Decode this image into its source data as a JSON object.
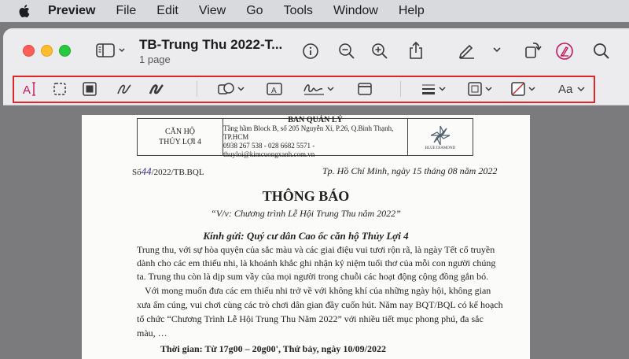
{
  "menubar": {
    "app_name": "Preview",
    "items": [
      "File",
      "Edit",
      "View",
      "Go",
      "Tools",
      "Window",
      "Help"
    ]
  },
  "window": {
    "title": "TB-Trung Thu 2022-T...",
    "subtitle": "1 page",
    "font_size_label": "Aa"
  },
  "document": {
    "header_left_1": "CĂN HỘ",
    "header_left_2": "THỦY LỢI 4",
    "header_mid_title": "BAN QUẢN LÝ",
    "header_mid_1": "Tầng hầm Block B, số 205 Nguyễn Xí, P.26, Q.Bình Thạnh, TP.HCM",
    "header_mid_2": "0938 267 538 - 028 6682 5571 - thuyloi@kimcuongxanh.com.vn",
    "logo_text": "BLUE DIAMOND",
    "ref_prefix": "Số",
    "ref_handwritten": "44",
    "ref_suffix": "/2022/TB.BQL",
    "date": "Tp. Hồ Chí Minh, ngày 15 tháng 08 năm 2022",
    "heading": "THÔNG BÁO",
    "subject": "“V/v: Chương trình Lễ Hội Trung Thu năm 2022”",
    "salutation": "Kính gửi: Quý cư dân Cao ốc căn hộ Thủy Lợi 4",
    "paragraph1": [
      "Trung thu, với sự hòa quyện của sắc màu và các giai điệu vui tươi rộn rã, là ngày Tết cổ truyền",
      "dành cho các em thiếu nhi, là khoảnh khắc ghi nhận kỷ niệm tuổi thơ của mỗi con người chúng",
      "ta. Trung thu còn là dịp sum vầy của mọi người trong chuỗi các hoạt động cộng đồng gắn bó."
    ],
    "paragraph2": [
      "Với mong muốn đưa các em thiếu nhi trở về với không khí của những ngày hội, không gian",
      "xưa ấm cúng, vui chơi cùng các trò chơi dân gian đầy cuốn hút. Năm nay BQT/BQL có kế hoạch",
      "tổ chức “Chương Trình Lễ Hội Trung Thu Năm 2022” với nhiều tiết mục phong phú, đa sắc",
      "màu, …"
    ],
    "partial_line": "Thời gian: Từ 17g00 – 20g00', Thứ bảy, ngày 10/09/2022"
  },
  "colors": {
    "highlight_box": "#e0262a",
    "markup_accent": "#c2185b"
  }
}
